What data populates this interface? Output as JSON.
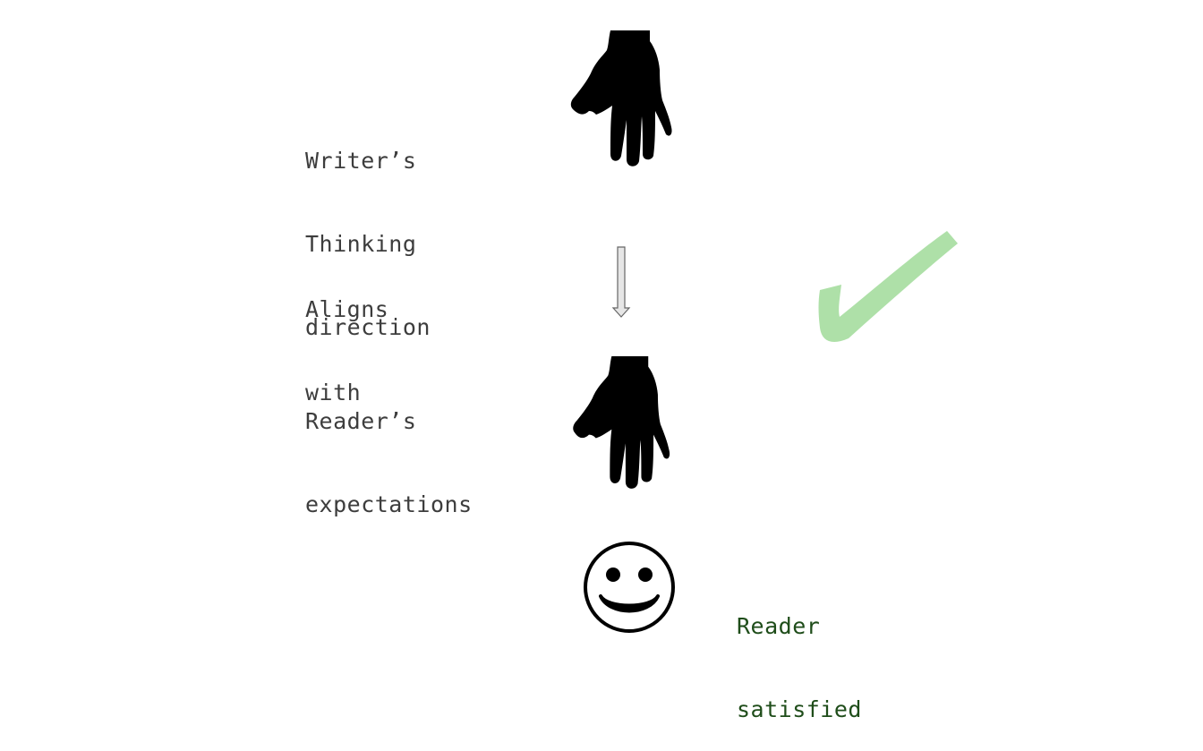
{
  "labels": {
    "writer": [
      "Writer’s",
      "Thinking",
      "direction"
    ],
    "aligns": [
      "Aligns",
      "with"
    ],
    "reader": [
      "Reader’s",
      "expectations"
    ],
    "satisfied": [
      "Reader",
      "satisfied"
    ]
  },
  "icons": {
    "top_hand": "hand-icon",
    "bottom_hand": "hand-icon",
    "arrow": "down-arrow-icon",
    "check": "check-mark-icon",
    "face": "smiley-face-icon"
  },
  "colors": {
    "text": "#3d3d3d",
    "satisfied_text": "#1f4d1a",
    "check": "#aee0a8",
    "icon": "#000000",
    "arrow_fill": "#e6e6e6",
    "arrow_stroke": "#666666"
  }
}
